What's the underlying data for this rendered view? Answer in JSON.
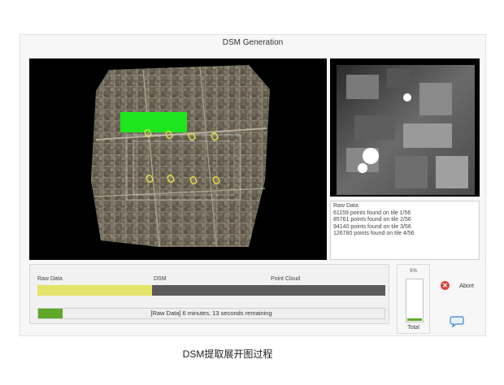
{
  "window": {
    "title": "DSM Generation"
  },
  "log": {
    "header": "Raw Data",
    "lines": [
      "61159 points found on tile 1/56",
      "85761 points found on tile 2/56",
      "94140 points found on tile 3/56",
      "126780 points found on tile 4/56"
    ]
  },
  "stages": {
    "items": [
      "Raw Data",
      "DSM",
      "Point Cloud"
    ],
    "progress": 0.33
  },
  "timebar": {
    "text": "[Raw Data] 6 minutes, 13 seconds remaining",
    "progress": 0.07
  },
  "total": {
    "percent": "5%",
    "label": "Total",
    "progress": 0.05
  },
  "abort": {
    "label": "Abort",
    "icon": "abort-x-icon"
  },
  "feedback": {
    "icon": "chat-bubble-icon"
  },
  "caption": "DSM提取展开图过程",
  "colors": {
    "stage_fill": "#e4e46a",
    "progress_green": "#5fa82a",
    "overlay_green": "#1ee61e",
    "marker_yellow": "#e7e04a"
  }
}
